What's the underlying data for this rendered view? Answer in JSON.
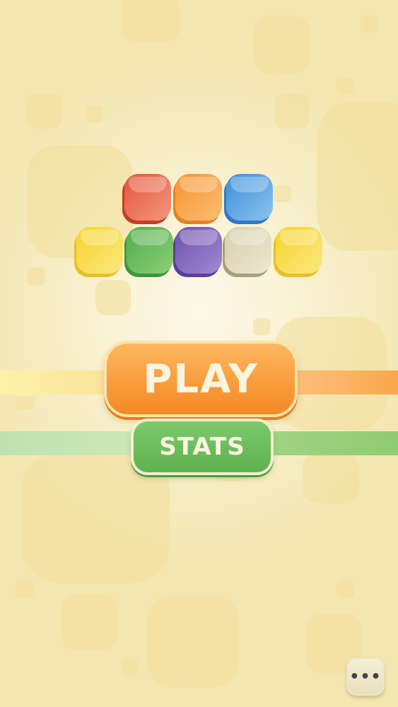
{
  "buttons": {
    "play_label": "PLAY",
    "stats_label": "STATS",
    "menu_label": "•••"
  },
  "logo_tiles": [
    {
      "color": "#ec6b4d"
    },
    {
      "color": "#f9a04b"
    },
    {
      "color": "#4f9fe0"
    },
    {
      "color": "#f7d93a"
    },
    {
      "color": "#5fb555"
    },
    {
      "color": "#7f5fb4"
    },
    {
      "color": "#e0d9bd"
    },
    {
      "color": "#f7d93a"
    }
  ],
  "colors": {
    "play": "#f99a3a",
    "stats": "#5fb14f",
    "background": "#f8f0cc"
  },
  "icons": {
    "menu": "more-dots-icon"
  }
}
